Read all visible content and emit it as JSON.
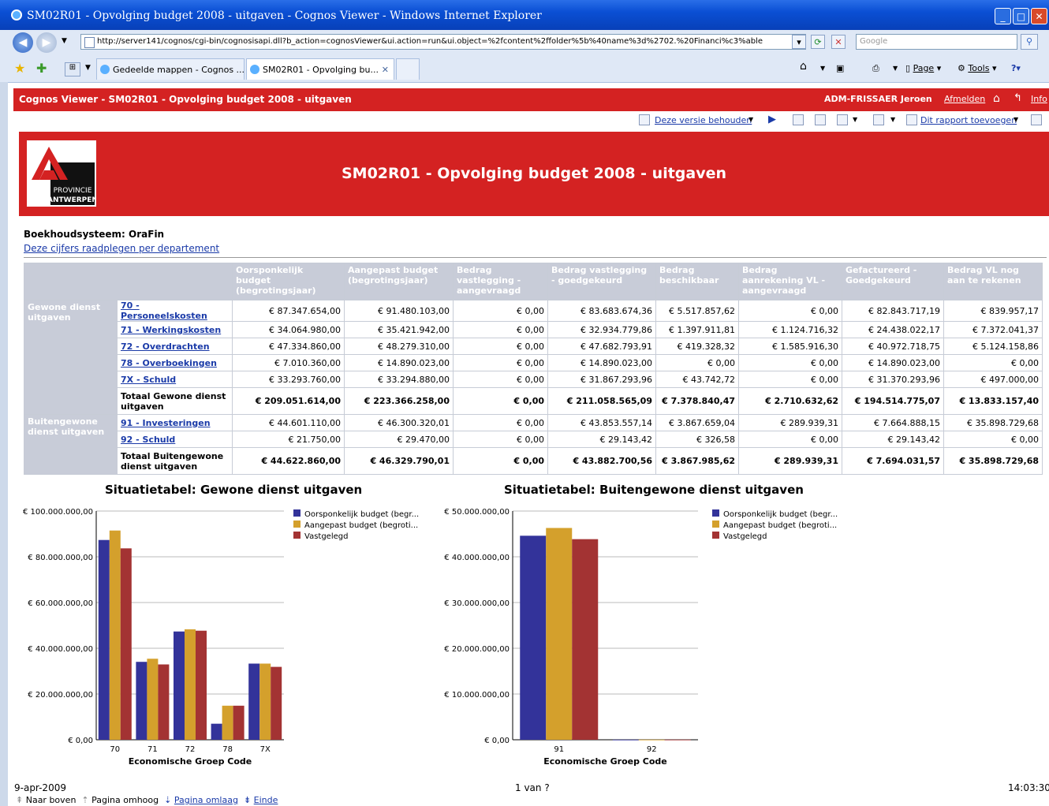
{
  "window": {
    "title": "SM02R01 - Opvolging budget 2008 - uitgaven - Cognos Viewer - Windows Internet Explorer"
  },
  "browser": {
    "url": "http://server141/cognos/cgi-bin/cognosisapi.dll?b_action=cognosViewer&ui.action=run&ui.object=%2fcontent%2ffolder%5b%40name%3d%2702.%20Financi%c3%able",
    "search_placeholder": "Google",
    "tabs": [
      {
        "label": "Gedeelde mappen - Cognos ..."
      },
      {
        "label": "SM02R01 - Opvolging bu..."
      }
    ],
    "tools": {
      "page": "Page",
      "tools": "Tools"
    }
  },
  "cognos": {
    "header_title": "Cognos Viewer - SM02R01 - Opvolging budget 2008 - uitgaven",
    "user": "ADM-FRISSAER Jeroen",
    "logout": "Afmelden",
    "info": "Info",
    "keep_version": "Deze versie behouden",
    "add_report": "Dit rapport toevoegen"
  },
  "report": {
    "logo_text1": "PROVINCIE",
    "logo_text2": "ANTWERPEN",
    "title": "SM02R01 - Opvolging budget 2008 - uitgaven",
    "system": "Boekhoudsysteem: OraFin",
    "dept_link": "Deze cijfers raadplegen per departement",
    "columns": [
      "Oorsponkelijk budget (begrotingsjaar)",
      "Aangepast budget (begrotingsjaar)",
      "Bedrag vastlegging - aangevraagd",
      "Bedrag vastlegging - goedgekeurd",
      "Bedrag beschikbaar",
      "Bedrag aanrekening VL - aangevraagd",
      "Gefactureerd - Goedgekeurd",
      "Bedrag VL nog aan te rekenen"
    ],
    "groups": [
      {
        "name": "Gewone dienst uitgaven",
        "rows": [
          {
            "label": "70 - Personeelskosten",
            "values": [
              "€ 87.347.654,00",
              "€ 91.480.103,00",
              "€ 0,00",
              "€ 83.683.674,36",
              "€ 5.517.857,62",
              "€ 0,00",
              "€ 82.843.717,19",
              "€ 839.957,17"
            ]
          },
          {
            "label": "71 - Werkingskosten",
            "values": [
              "€ 34.064.980,00",
              "€ 35.421.942,00",
              "€ 0,00",
              "€ 32.934.779,86",
              "€ 1.397.911,81",
              "€ 1.124.716,32",
              "€ 24.438.022,17",
              "€ 7.372.041,37"
            ]
          },
          {
            "label": "72 - Overdrachten",
            "values": [
              "€ 47.334.860,00",
              "€ 48.279.310,00",
              "€ 0,00",
              "€ 47.682.793,91",
              "€ 419.328,32",
              "€ 1.585.916,30",
              "€ 40.972.718,75",
              "€ 5.124.158,86"
            ]
          },
          {
            "label": "78 - Overboekingen",
            "values": [
              "€ 7.010.360,00",
              "€ 14.890.023,00",
              "€ 0,00",
              "€ 14.890.023,00",
              "€ 0,00",
              "€ 0,00",
              "€ 14.890.023,00",
              "€ 0,00"
            ]
          },
          {
            "label": "7X - Schuld",
            "values": [
              "€ 33.293.760,00",
              "€ 33.294.880,00",
              "€ 0,00",
              "€ 31.867.293,96",
              "€ 43.742,72",
              "€ 0,00",
              "€ 31.370.293,96",
              "€ 497.000,00"
            ]
          }
        ],
        "total": {
          "label": "Totaal Gewone dienst uitgaven",
          "values": [
            "€ 209.051.614,00",
            "€ 223.366.258,00",
            "€ 0,00",
            "€ 211.058.565,09",
            "€ 7.378.840,47",
            "€ 2.710.632,62",
            "€ 194.514.775,07",
            "€ 13.833.157,40"
          ]
        }
      },
      {
        "name": "Buitengewone dienst uitgaven",
        "rows": [
          {
            "label": "91 - Investeringen",
            "values": [
              "€ 44.601.110,00",
              "€ 46.300.320,01",
              "€ 0,00",
              "€ 43.853.557,14",
              "€ 3.867.659,04",
              "€ 289.939,31",
              "€ 7.664.888,15",
              "€ 35.898.729,68"
            ]
          },
          {
            "label": "92 - Schuld",
            "values": [
              "€ 21.750,00",
              "€ 29.470,00",
              "€ 0,00",
              "€ 29.143,42",
              "€ 326,58",
              "€ 0,00",
              "€ 29.143,42",
              "€ 0,00"
            ]
          }
        ],
        "total": {
          "label": "Totaal Buitengewone dienst uitgaven",
          "values": [
            "€ 44.622.860,00",
            "€ 46.329.790,01",
            "€ 0,00",
            "€ 43.882.700,56",
            "€ 3.867.985,62",
            "€ 289.939,31",
            "€ 7.694.031,57",
            "€ 35.898.729,68"
          ]
        }
      }
    ],
    "footer": {
      "date": "9-apr-2009",
      "pages": "1 van ?",
      "time": "14:03:30",
      "nav_top": "Naar boven",
      "nav_up": "Pagina omhoog",
      "nav_down": "Pagina omlaag",
      "nav_end": "Einde"
    }
  },
  "colors": {
    "bar1": "#33339a",
    "bar2": "#d4a02c",
    "bar3": "#a33333",
    "red": "#d42222"
  },
  "chart_data": [
    {
      "type": "bar",
      "title": "Situatietabel: Gewone dienst uitgaven",
      "xlabel": "Economische Groep Code",
      "ylabel": "",
      "categories": [
        "70",
        "71",
        "72",
        "78",
        "7X"
      ],
      "series": [
        {
          "name": "Oorsponkelijk budget (begr...",
          "values": [
            87347654,
            34064980,
            47334860,
            7010360,
            33293760
          ]
        },
        {
          "name": "Aangepast budget (begroti...",
          "values": [
            91480103,
            35421942,
            48279310,
            14890023,
            33294880
          ]
        },
        {
          "name": "Vastgelegd",
          "values": [
            83683674.36,
            32934779.86,
            47682793.91,
            14890023,
            31867293.96
          ]
        }
      ],
      "ylim": [
        0,
        100000000
      ],
      "yticks": [
        "€ 0,00",
        "€ 20.000.000,00",
        "€ 40.000.000,00",
        "€ 60.000.000,00",
        "€ 80.000.000,00",
        "€ 100.000.000,00"
      ],
      "legend": "top-right",
      "grid": true
    },
    {
      "type": "bar",
      "title": "Situatietabel: Buitengewone dienst uitgaven",
      "xlabel": "Economische Groep Code",
      "ylabel": "",
      "categories": [
        "91",
        "92"
      ],
      "series": [
        {
          "name": "Oorsponkelijk budget (begr...",
          "values": [
            44601110,
            21750
          ]
        },
        {
          "name": "Aangepast budget (begroti...",
          "values": [
            46300320.01,
            29470
          ]
        },
        {
          "name": "Vastgelegd",
          "values": [
            43853557.14,
            29143.42
          ]
        }
      ],
      "ylim": [
        0,
        50000000
      ],
      "yticks": [
        "€ 0,00",
        "€ 10.000.000,00",
        "€ 20.000.000,00",
        "€ 30.000.000,00",
        "€ 40.000.000,00",
        "€ 50.000.000,00"
      ],
      "legend": "top-right",
      "grid": true
    }
  ]
}
